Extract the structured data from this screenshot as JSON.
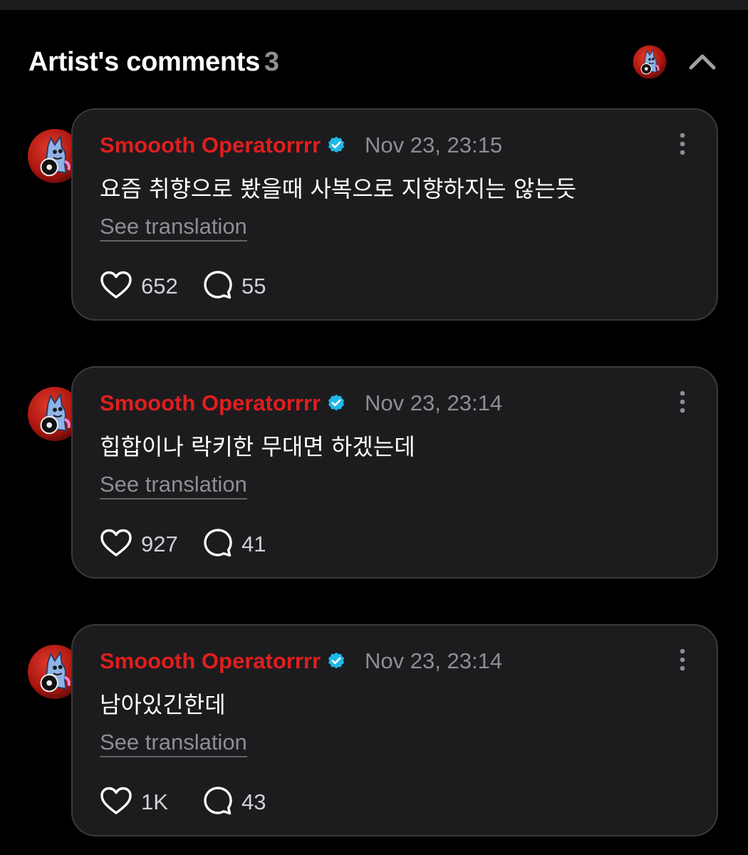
{
  "header": {
    "title": "Artist's comments",
    "count": "3"
  },
  "colors": {
    "background": "#000000",
    "card": "#1c1c1e",
    "username": "#e01e1e",
    "verified": "#1fb8e8",
    "muted": "#8e8e93"
  },
  "icons": {
    "like": "heart-icon",
    "reply": "speech-bubble-icon",
    "more": "vertical-ellipsis-icon",
    "collapse": "chevron-up-icon",
    "verified": "verified-badge-icon"
  },
  "comments": [
    {
      "username": "Smoooth Operatorrrr",
      "timestamp": "Nov 23, 23:15",
      "text": "요즘 취향으로 봤을때 사복으로 지향하지는 않는듯",
      "translate_label": "See translation",
      "likes": "652",
      "replies": "55"
    },
    {
      "username": "Smoooth Operatorrrr",
      "timestamp": "Nov 23, 23:14",
      "text": "힙합이나 락키한 무대면 하겠는데",
      "translate_label": "See translation",
      "likes": "927",
      "replies": "41"
    },
    {
      "username": "Smoooth Operatorrrr",
      "timestamp": "Nov 23, 23:14",
      "text": "남아있긴한데",
      "translate_label": "See translation",
      "likes": "1K",
      "replies": "43"
    }
  ]
}
